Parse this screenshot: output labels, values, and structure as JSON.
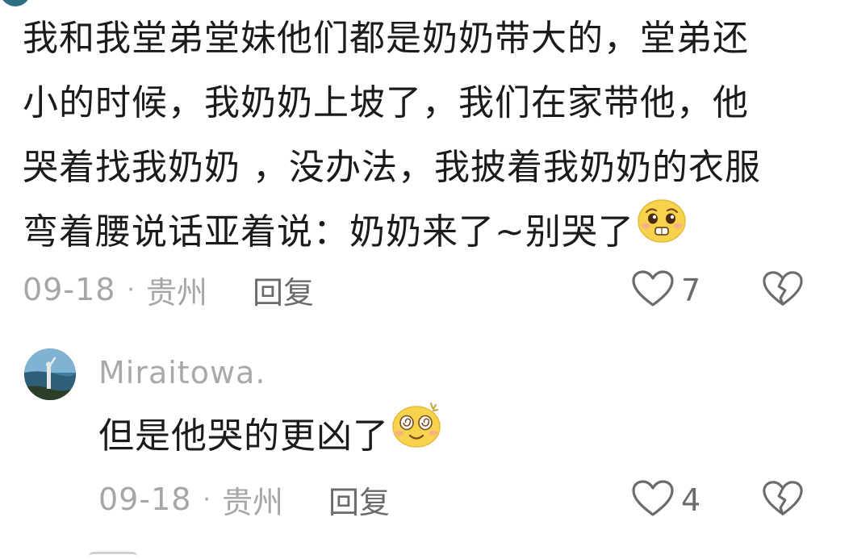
{
  "comment1": {
    "lines": [
      "我和我堂弟堂妹他们都是奶奶带大的，堂弟还",
      "小的时候，我奶奶上坡了，我们在家带他，他",
      "哭着找我奶奶 ，没办法，我披着我奶奶的衣服",
      "弯着腰说话亚着说：奶奶来了~别哭了"
    ],
    "emoji": "pleading-face-icon",
    "date": "09-18",
    "separator": "·",
    "location": "贵州",
    "reply_label": "回复",
    "like_count": "7"
  },
  "comment2": {
    "username": "Miraitowa.",
    "text": "但是他哭的更凶了",
    "emoji": "dizzy-face-icon",
    "date": "09-18",
    "separator": "·",
    "location": "贵州",
    "reply_label": "回复",
    "like_count": "4"
  },
  "colors": {
    "text_primary": "#1b1b1b",
    "text_meta": "#a6a6a6",
    "text_reply": "#6b6b6b",
    "icon_stroke": "#6b6b6b",
    "emoji_yellow": "#f7d24d"
  }
}
